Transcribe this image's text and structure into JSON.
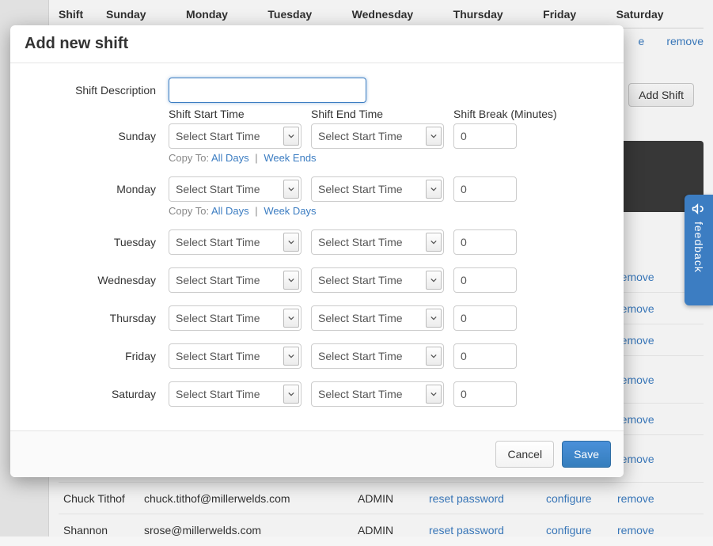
{
  "background": {
    "shift_header": [
      "Shift",
      "Sunday",
      "Monday",
      "Tuesday",
      "Wednesday",
      "Thursday",
      "Friday",
      "Saturday"
    ],
    "row1_actions": {
      "configure_partial": "e",
      "remove": "remove"
    },
    "add_shift_btn": "Add Shift",
    "users": [
      {
        "name": "",
        "email": "",
        "role": "",
        "reset": "",
        "configure": "",
        "remove": "remove"
      },
      {
        "name": "",
        "email": "",
        "role": "",
        "reset": "",
        "configure": "",
        "remove": "remove"
      },
      {
        "name": "",
        "email": "",
        "role": "",
        "reset": "",
        "configure": "",
        "remove": "remove"
      },
      {
        "name": "",
        "email": "",
        "role": "",
        "reset": "",
        "configure": "",
        "remove": "remove"
      },
      {
        "name": "",
        "email": "",
        "role": "",
        "reset": "",
        "configure": "",
        "remove": "remove"
      },
      {
        "name": "",
        "email": "",
        "role": "",
        "reset": "",
        "configure": "",
        "remove": "remove"
      },
      {
        "name": "Chuck Tithof",
        "email": "chuck.tithof@millerwelds.com",
        "role": "ADMIN",
        "reset": "reset password",
        "configure": "configure",
        "remove": "remove"
      },
      {
        "name": "Shannon",
        "email": "srose@millerwelds.com",
        "role": "ADMIN",
        "reset": "reset password",
        "configure": "configure",
        "remove": "remove"
      }
    ]
  },
  "modal": {
    "title": "Add new shift",
    "description_label": "Shift Description",
    "description_value": "",
    "col_headers": {
      "start": "Shift Start Time",
      "end": "Shift End Time",
      "break": "Shift Break (Minutes)"
    },
    "select_placeholder": "Select Start Time",
    "break_default": "0",
    "copy_prefix": "Copy To:",
    "copy_all": "All Days",
    "copy_weekends": "Week Ends",
    "copy_weekdays": "Week Days",
    "days": {
      "sunday": {
        "label": "Sunday"
      },
      "monday": {
        "label": "Monday"
      },
      "tuesday": {
        "label": "Tuesday"
      },
      "wednesday": {
        "label": "Wednesday"
      },
      "thursday": {
        "label": "Thursday"
      },
      "friday": {
        "label": "Friday"
      },
      "saturday": {
        "label": "Saturday"
      }
    },
    "cancel": "Cancel",
    "save": "Save"
  },
  "feedback": {
    "label": "feedback"
  }
}
